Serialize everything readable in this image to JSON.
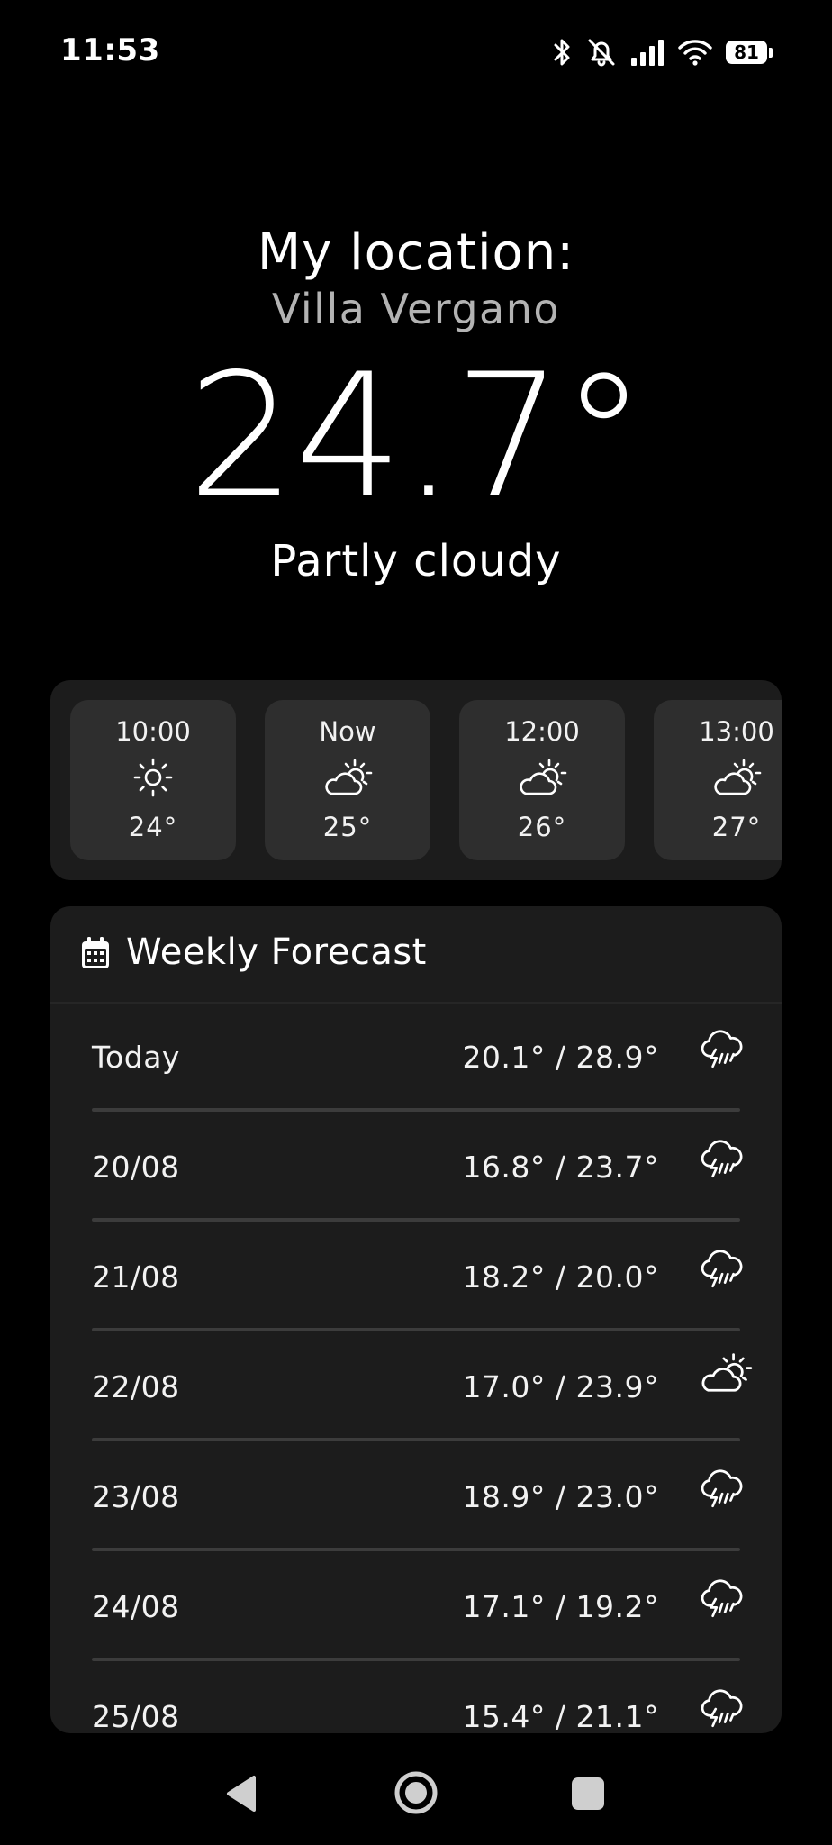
{
  "status_bar": {
    "time": "11:53",
    "battery": "81"
  },
  "location": {
    "label": "My location:",
    "name": "Villa Vergano"
  },
  "current": {
    "temperature": "24.7°",
    "condition": "Partly cloudy"
  },
  "hourly": [
    {
      "time": "10:00",
      "icon": "sun-icon",
      "temp": "24°"
    },
    {
      "time": "Now",
      "icon": "partly-cloudy-icon",
      "temp": "25°"
    },
    {
      "time": "12:00",
      "icon": "partly-cloudy-icon",
      "temp": "26°"
    },
    {
      "time": "13:00",
      "icon": "partly-cloudy-icon",
      "temp": "27°"
    }
  ],
  "weekly": {
    "title": "Weekly Forecast",
    "days": [
      {
        "day": "Today",
        "temps": "20.1° / 28.9°",
        "icon": "thunderstorm-icon"
      },
      {
        "day": "20/08",
        "temps": "16.8° / 23.7°",
        "icon": "thunderstorm-icon"
      },
      {
        "day": "21/08",
        "temps": "18.2° / 20.0°",
        "icon": "thunderstorm-icon"
      },
      {
        "day": "22/08",
        "temps": "17.0° / 23.9°",
        "icon": "partly-cloudy-icon"
      },
      {
        "day": "23/08",
        "temps": "18.9° / 23.0°",
        "icon": "thunderstorm-icon"
      },
      {
        "day": "24/08",
        "temps": "17.1° / 19.2°",
        "icon": "thunderstorm-icon"
      },
      {
        "day": "25/08",
        "temps": "15.4° / 21.1°",
        "icon": "thunderstorm-icon"
      }
    ]
  }
}
